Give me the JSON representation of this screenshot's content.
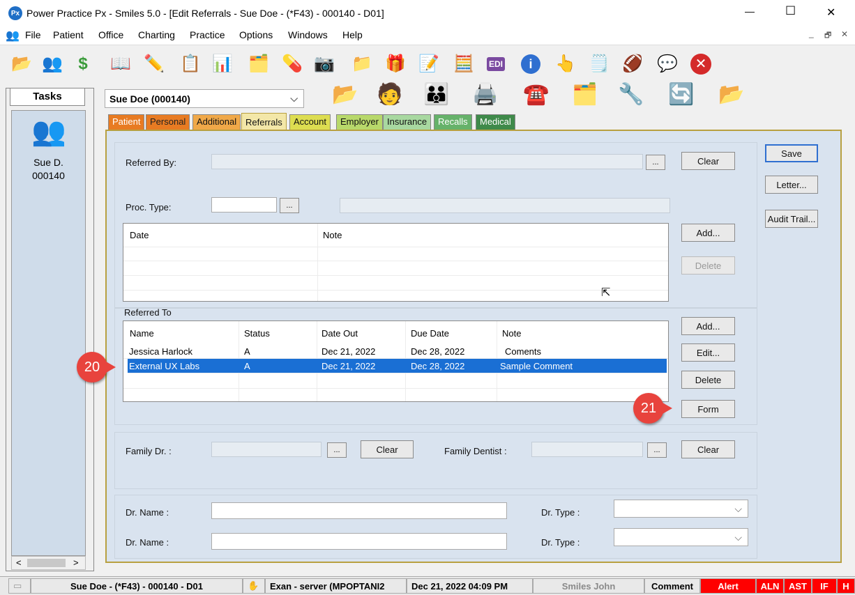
{
  "window": {
    "title": "Power Practice Px - Smiles 5.0 - [Edit Referrals - Sue Doe - (*F43) - 000140 - D01]",
    "app_icon_text": "Px",
    "minimize": "—",
    "maximize": "☐",
    "close": "✕"
  },
  "menu": {
    "items": [
      "File",
      "Patient",
      "Office",
      "Charting",
      "Practice",
      "Options",
      "Windows",
      "Help"
    ],
    "mdi_min": "_",
    "mdi_restore": "🗗",
    "mdi_close": "✕"
  },
  "toolbar": {
    "icons": [
      "open-folder-icon",
      "patients-icon",
      "dollar-icon",
      "book-icon",
      "chart-pencil-icon",
      "clipboard-icon",
      "chart-grid-icon",
      "folder-tools-icon",
      "medicine-icon",
      "camera-icon",
      "folders-icon",
      "gift-icon",
      "checklist-icon",
      "calculator-icon",
      "edi-icon",
      "info-icon",
      "hand-pointer-icon",
      "notepad-icon",
      "football-icon",
      "chat-icon",
      "exit-icon"
    ]
  },
  "tasks": {
    "header": "Tasks",
    "patient_name": "Sue D.",
    "patient_id": "000140"
  },
  "patient_select": {
    "value": "Sue Doe (000140)",
    "arrow": "⌵"
  },
  "tabs": [
    {
      "label": "Patient",
      "color": "#e87b22"
    },
    {
      "label": "Personal",
      "color": "#e87b22"
    },
    {
      "label": "Additional",
      "color": "#f0a848"
    },
    {
      "label": "Referrals",
      "color": "#f3e7a8"
    },
    {
      "label": "Account",
      "color": "#dddd50"
    },
    {
      "label": "Employer",
      "color": "#b8d86a"
    },
    {
      "label": "Insurance",
      "color": "#a8d8a0"
    },
    {
      "label": "Recalls",
      "color": "#66b26a"
    },
    {
      "label": "Medical",
      "color": "#3f8a4a"
    }
  ],
  "referred_by": {
    "label": "Referred By:",
    "value": "",
    "browse": "...",
    "clear": "Clear"
  },
  "proc_type": {
    "label": "Proc. Type:",
    "value": "",
    "browse": "..."
  },
  "notes_grid": {
    "headers": [
      "Date",
      "Note"
    ],
    "add": "Add...",
    "delete": "Delete"
  },
  "referred_to": {
    "label": "Referred To",
    "headers": [
      "Name",
      "Status",
      "Date Out",
      "Due Date",
      "Note"
    ],
    "rows": [
      {
        "name": "Jessica Harlock",
        "status": "A",
        "date_out": "Dec 21, 2022",
        "due_date": "Dec 28, 2022",
        "note": "Coments"
      },
      {
        "name": "External UX Labs",
        "status": "A",
        "date_out": "Dec 21, 2022",
        "due_date": "Dec 28, 2022",
        "note": "Sample Comment"
      }
    ],
    "add": "Add...",
    "edit": "Edit...",
    "delete": "Delete",
    "form": "Form"
  },
  "family": {
    "dr_label": "Family Dr. :",
    "dentist_label": "Family Dentist :",
    "browse": "...",
    "clear": "Clear"
  },
  "doctors": {
    "name_label": "Dr. Name :",
    "type_label": "Dr. Type :"
  },
  "side_buttons": {
    "save": "Save",
    "letter": "Letter...",
    "audit": "Audit Trail..."
  },
  "callouts": {
    "c20": "20",
    "c21": "21"
  },
  "statusbar": {
    "patient": "Sue Doe - (*F43) - 000140 - D01",
    "exam": "Exan - server (MPOPTANI2",
    "datetime": "Dec 21, 2022 04:09 PM",
    "user": "Smiles John",
    "comment": "Comment",
    "alert": "Alert",
    "aln": "ALN",
    "ast": "AST",
    "if": "IF",
    "h": "H"
  },
  "scroll": {
    "left": "<",
    "right": ">"
  }
}
